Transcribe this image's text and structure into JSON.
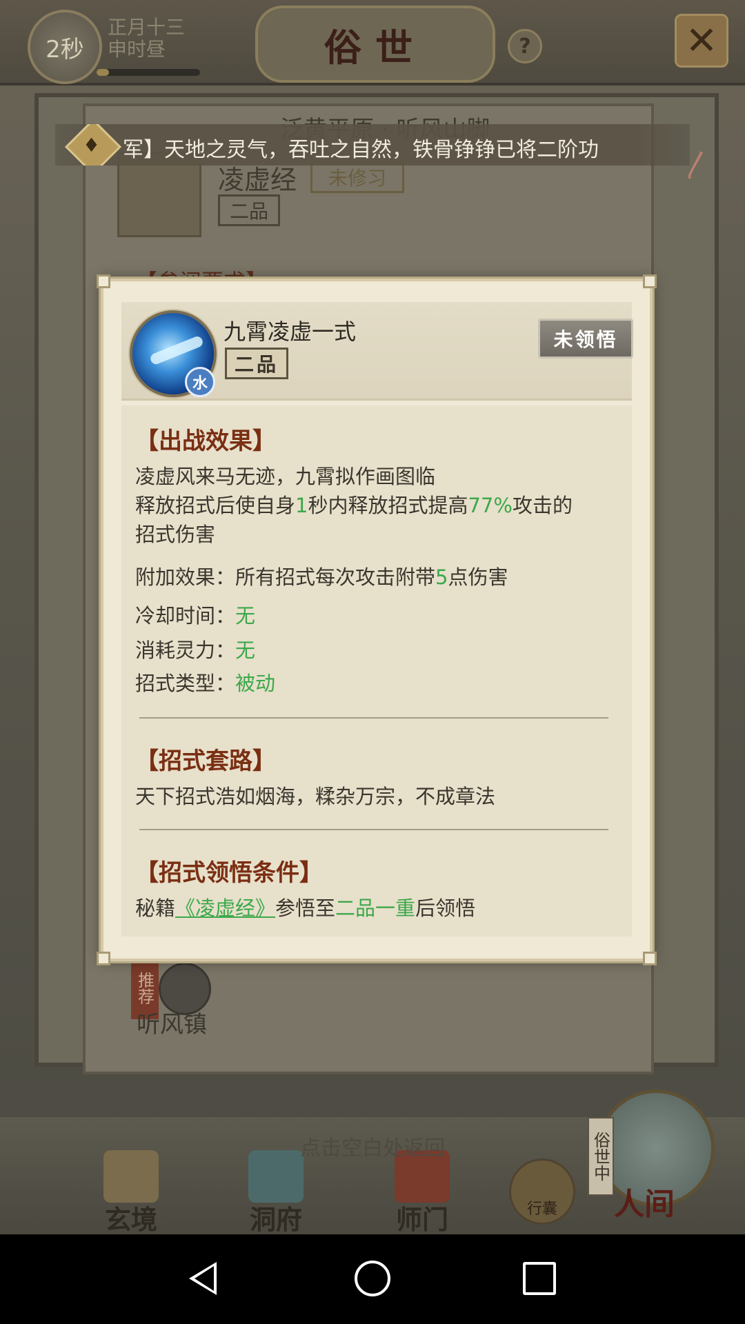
{
  "top_bar": {
    "timer": "2秒",
    "date_line1": "正月十三",
    "date_line2": "申时昼",
    "progress": 0.12,
    "title": "俗世",
    "help_icon": "question-icon",
    "close_icon": "close-x-icon"
  },
  "notice": {
    "text": "军】天地之灵气，吞吐之自然，铁骨铮铮已将二阶功",
    "icon": "bell-icon"
  },
  "background": {
    "top_text": "泛黄平原 · 听风山脚",
    "book_name": "凌虚经",
    "book_status": "未修习",
    "book_grade": "二品",
    "section": "【参阅要求】",
    "town_badge": "推荐",
    "town_name": "听风镇",
    "hint": "点击空白处返回"
  },
  "modal": {
    "skill_name": "九霄凌虚一式",
    "grade": "二品",
    "element": "水",
    "status_button": "未领悟",
    "sections": {
      "battle_effect_title": "【出战效果】",
      "battle_line1": "凌虚风来马无迹，九霄拟作画图临",
      "battle_line2_a": "释放招式后使自身",
      "battle_line2_sec": "1",
      "battle_line2_b": "秒内释放招式提高",
      "battle_line2_pct": "77%",
      "battle_line2_c": "攻击的",
      "battle_line3": "招式伤害",
      "extra_a": "附加效果：所有招式每次攻击附带",
      "extra_num": "5",
      "extra_b": "点伤害",
      "cooldown_label": "冷却时间：",
      "cooldown_value": "无",
      "cost_label": "消耗灵力：",
      "cost_value": "无",
      "type_label": "招式类型：",
      "type_value": "被动",
      "routine_title": "【招式套路】",
      "routine_text": "天下招式浩如烟海，糅杂万宗，不成章法",
      "condition_title": "【招式领悟条件】",
      "cond_a": "秘籍",
      "cond_book": "《凌虚经》",
      "cond_b": "参悟至",
      "cond_level": "二品一重",
      "cond_c": "后领悟"
    }
  },
  "bottom_nav": {
    "items": [
      "玄境",
      "洞府",
      "师门"
    ],
    "bag": "行囊",
    "renjian_tag": "俗世中",
    "renjian": "人间"
  },
  "colors": {
    "accent_green": "#3ca84a",
    "section_red": "#7a2e12",
    "modal_bg": "#efe9d6"
  }
}
